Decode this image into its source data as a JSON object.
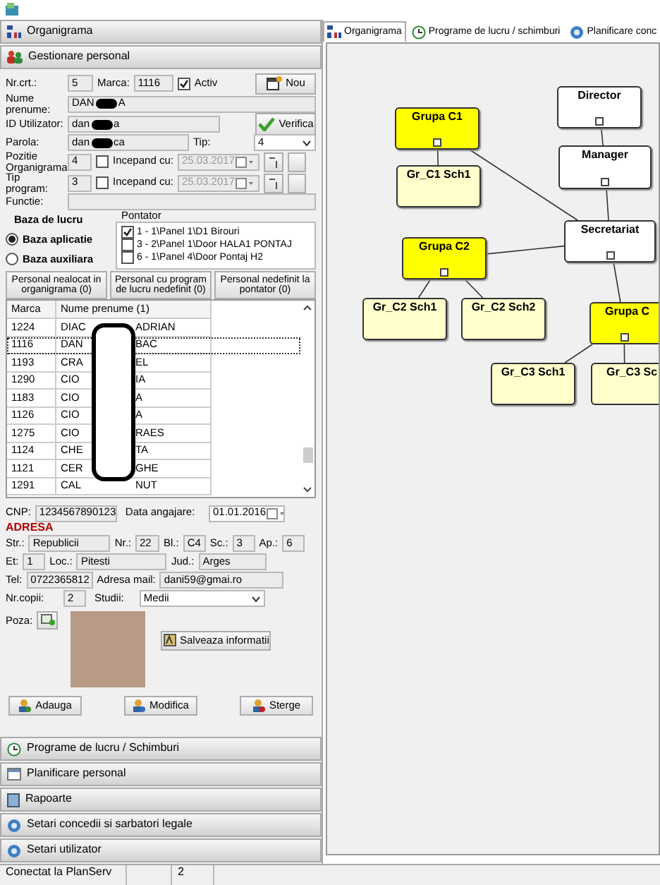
{
  "accordion_top": [
    "Organigrama",
    "Gestionare personal"
  ],
  "form": {
    "nr_crt": {
      "label": "Nr.crt.:",
      "value": "5"
    },
    "marca": {
      "label": "Marca:",
      "value": "1116"
    },
    "activ": {
      "label": "Activ",
      "checked": true
    },
    "new_button": "Nou",
    "name": {
      "label": "Nume prenume:",
      "value_start": "DAN",
      "value_end": "A"
    },
    "user_id": {
      "label": "ID Utilizator:",
      "value_start": "dan",
      "value_end": "a"
    },
    "verify_button": "Verifica",
    "password": {
      "label": "Parola:",
      "value_start": "dan",
      "value_end": "ca"
    },
    "type": {
      "label": "Tip:",
      "value": "4"
    },
    "position": {
      "label": "Pozitie Organigrama:",
      "value": "4",
      "since_label": "Incepand cu:",
      "since_checked": false,
      "date": "25.03.2017"
    },
    "schedule": {
      "label": "Tip program:",
      "value": "3",
      "since_label": "Incepand cu:",
      "since_checked": false,
      "date": "25.03.2017"
    },
    "function": {
      "label": "Functie:"
    }
  },
  "work_base": {
    "title": "Baza de lucru",
    "options": [
      {
        "label": "Baza aplicatie",
        "selected": true
      },
      {
        "label": "Baza auxiliara",
        "selected": false
      }
    ]
  },
  "pontator": {
    "title": "Pontator",
    "items": [
      {
        "label": "1 - 1\\Panel 1\\D1 Birouri",
        "checked": true
      },
      {
        "label": "3 - 2\\Panel 1\\Door HALA1 PONTAJ",
        "checked": false
      },
      {
        "label": "6 - 1\\Panel 4\\Door Pontaj H2",
        "checked": false
      }
    ]
  },
  "filter_buttons": [
    "Personal nealocat in organigrama (0)",
    "Personal cu program de lucru nedefinit (0)",
    "Personal nedefinit la pontator (0)"
  ],
  "table": {
    "columns": [
      "Marca",
      "Nume prenume (1)"
    ],
    "rows": [
      {
        "marca": "1224",
        "name_start": "DIAC",
        "name_end": "ADRIAN",
        "selected": false
      },
      {
        "marca": "1116",
        "name_start": "DAN",
        "name_end": "BAC",
        "selected": true
      },
      {
        "marca": "1193",
        "name_start": "CRA",
        "name_end": "EL",
        "selected": false
      },
      {
        "marca": "1290",
        "name_start": "CIO",
        "name_end": "IA",
        "selected": false
      },
      {
        "marca": "1183",
        "name_start": "CIO",
        "name_end": "A",
        "selected": false
      },
      {
        "marca": "1126",
        "name_start": "CIO",
        "name_end": "A",
        "selected": false
      },
      {
        "marca": "1275",
        "name_start": "CIO",
        "name_end": "RAES",
        "selected": false
      },
      {
        "marca": "1124",
        "name_start": "CHE",
        "name_end": "TA",
        "selected": false
      },
      {
        "marca": "1121",
        "name_start": "CER",
        "name_end": "GHE",
        "selected": false
      },
      {
        "marca": "1291",
        "name_start": "CAL",
        "name_end": "NUT",
        "selected": false
      }
    ]
  },
  "details": {
    "cnp": {
      "label": "CNP:",
      "value": "1234567890123"
    },
    "hire_date": {
      "label": "Data angajare:",
      "value": "01.01.2016"
    },
    "address_title": "ADRESA",
    "street": {
      "label": "Str.:",
      "value": "Republicii"
    },
    "number": {
      "label": "Nr.:",
      "value": "22"
    },
    "block": {
      "label": "Bl.:",
      "value": "C4"
    },
    "staircase": {
      "label": "Sc.:",
      "value": "3"
    },
    "apartment": {
      "label": "Ap.:",
      "value": "6"
    },
    "floor": {
      "label": "Et:",
      "value": "1"
    },
    "city": {
      "label": "Loc.:",
      "value": "Pitesti"
    },
    "county": {
      "label": "Jud.:",
      "value": "Arges"
    },
    "phone": {
      "label": "Tel:",
      "value": "0722365812"
    },
    "email": {
      "label": "Adresa mail:",
      "value": "dani59@gmai.ro"
    },
    "children": {
      "label": "Nr.copii:",
      "value": "2"
    },
    "studies": {
      "label": "Studii:",
      "value": "Medii"
    },
    "photo_label": "Poza:",
    "save_button": "Salveaza informatii"
  },
  "actions": [
    "Adauga",
    "Modifica",
    "Sterge"
  ],
  "accordion_bottom": [
    "Programe de lucru / Schimburi",
    "Planificare personal",
    "Rapoarte",
    "Setari concedii si sarbatori legale",
    "Setari utilizator"
  ],
  "tabs": [
    {
      "label": "Organigrama",
      "selected": true
    },
    {
      "label": "Programe de lucru / schimburi",
      "selected": false
    },
    {
      "label": "Planificare conc",
      "selected": false
    }
  ],
  "org_chart": {
    "label": "Director",
    "kind": "unit",
    "children": [
      {
        "label": "Manager",
        "kind": "unit",
        "children": [
          {
            "label": "Secretariat",
            "kind": "unit",
            "children": [
              {
                "label": "Grupa C1",
                "kind": "group",
                "children": [
                  {
                    "label": "Gr_C1 Sch1",
                    "kind": "schedule"
                  }
                ]
              },
              {
                "label": "Grupa C2",
                "kind": "group",
                "children": [
                  {
                    "label": "Gr_C2 Sch1",
                    "kind": "schedule"
                  },
                  {
                    "label": "Gr_C2 Sch2",
                    "kind": "schedule"
                  }
                ]
              },
              {
                "label": "Grupa C",
                "kind": "group",
                "children": [
                  {
                    "label": "Gr_C3 Sch1",
                    "kind": "schedule"
                  },
                  {
                    "label": "Gr_C3 Sc",
                    "kind": "schedule"
                  }
                ]
              }
            ]
          }
        ]
      }
    ]
  },
  "status_bar": [
    "Conectat la PlanServ",
    "2"
  ]
}
